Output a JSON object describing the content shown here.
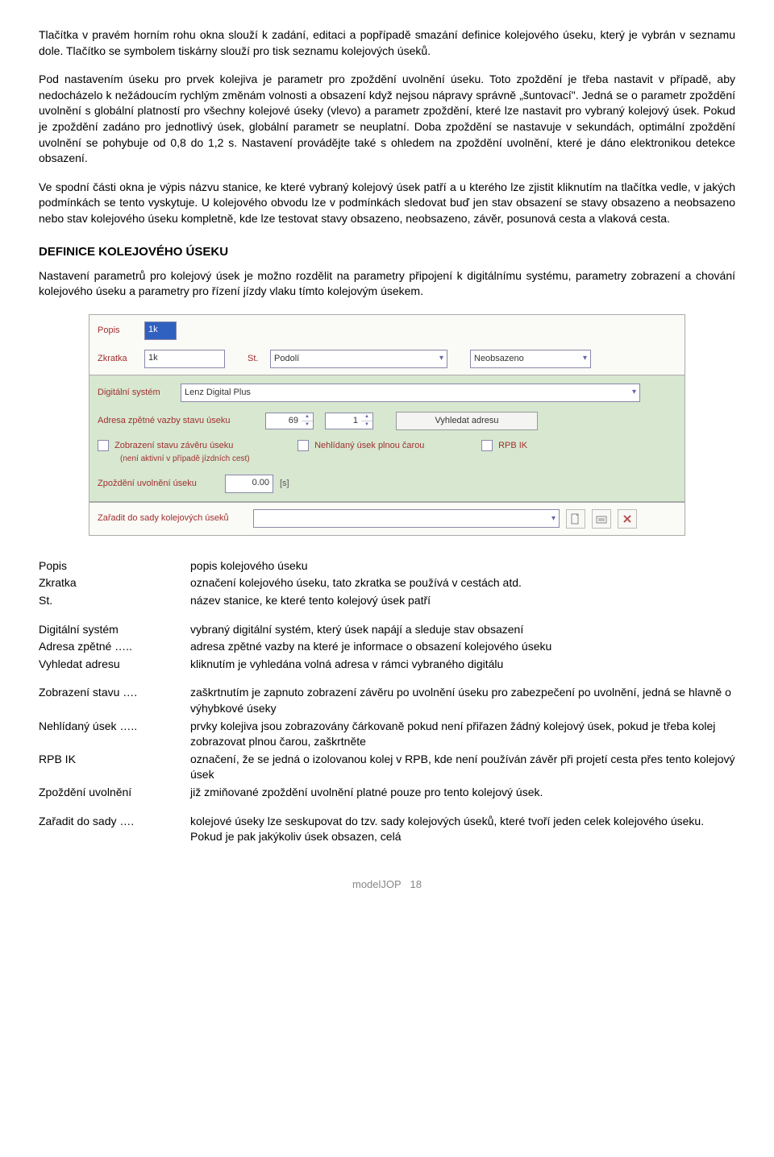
{
  "paragraphs": {
    "p1": "Tlačítka v pravém horním rohu okna slouží k zadání, editaci a popřípadě smazání definice kolejového úseku, který je vybrán v seznamu dole. Tlačítko se symbolem tiskárny slouží pro tisk seznamu kolejových úseků.",
    "p2": "Pod nastavením úseku pro prvek kolejiva je parametr pro zpoždění uvolnění úseku. Toto zpoždění je třeba nastavit v případě, aby nedocházelo k nežádoucím rychlým změnám volnosti a obsazení když nejsou nápravy správně „šuntovací\". Jedná se o parametr zpoždění uvolnění s globální platností pro všechny kolejové úseky (vlevo) a parametr zpoždění, které lze nastavit pro vybraný kolejový úsek. Pokud je zpoždění zadáno pro jednotlivý úsek, globální parametr se neuplatní. Doba zpoždění se nastavuje v sekundách, optimální zpoždění uvolnění se pohybuje od 0,8 do 1,2 s. Nastavení provádějte také s ohledem na zpoždění uvolnění, které je dáno elektronikou detekce obsazení.",
    "p3": "Ve spodní části okna je výpis názvu stanice, ke které vybraný kolejový úsek patří a u kterého lze zjistit kliknutím na tlačítka vedle, v jakých podmínkách se tento vyskytuje. U kolejového obvodu lze v podmínkách sledovat buď jen stav obsazení se stavy obsazeno a neobsazeno nebo stav kolejového úseku kompletně, kde lze testovat stavy obsazeno, neobsazeno, závěr, posunová cesta a vlaková cesta."
  },
  "heading": "DEFINICE KOLEJOVÉHO ÚSEKU",
  "def_intro": "Nastavení parametrů pro kolejový úsek je možno rozdělit na parametry připojení k digitálnímu systému, parametry zobrazení a chování kolejového úseku a parametry pro řízení jízdy vlaku tímto kolejovým úsekem.",
  "form": {
    "popis_label": "Popis",
    "popis_value": "1k",
    "zkratka_label": "Zkratka",
    "zkratka_value": "1k",
    "st_label": "St.",
    "st_value": "Podolí",
    "stav_value": "Neobsazeno",
    "system_label": "Digitální systém",
    "system_value": "Lenz Digital Plus",
    "adresa_label": "Adresa zpětné vazby stavu úseku",
    "adresa_val1": "69",
    "adresa_val2": "1",
    "vyhledat_btn": "Vyhledat adresu",
    "chk_zaver": "Zobrazení stavu závěru úseku",
    "chk_zaver_sub": "(není aktivní v případě jízdních cest)",
    "chk_nehlidany": "Nehlídaný úsek plnou čarou",
    "chk_rpb": "RPB IK",
    "zpozdeni_label": "Zpoždění uvolnění úseku",
    "zpozdeni_value": "0.00",
    "zpozdeni_unit": "[s]",
    "sada_label": "Zařadit do sady kolejových úseků"
  },
  "defs": [
    {
      "key": "Popis",
      "val": "popis kolejového úseku"
    },
    {
      "key": "Zkratka",
      "val": "označení kolejového úseku, tato zkratka se používá v cestách atd."
    },
    {
      "key": "St.",
      "val": "název stanice, ke které tento kolejový úsek patří"
    }
  ],
  "defs2": [
    {
      "key": "Digitální systém",
      "val": "vybraný digitální systém, který úsek napájí a sleduje stav obsazení"
    },
    {
      "key": "Adresa zpětné …..",
      "val": "adresa zpětné vazby na které je informace o obsazení kolejového úseku"
    },
    {
      "key": "Vyhledat adresu",
      "val": "kliknutím je vyhledána volná adresa v rámci vybraného digitálu"
    }
  ],
  "defs3": [
    {
      "key": "Zobrazení stavu ….",
      "val": "zaškrtnutím je zapnuto zobrazení závěru po uvolnění úseku pro zabezpečení po uvolnění, jedná se hlavně o výhybkové úseky"
    },
    {
      "key": "Nehlídaný úsek …..",
      "val": "prvky kolejiva jsou zobrazovány čárkovaně pokud není přiřazen žádný kolejový úsek, pokud je třeba kolej zobrazovat plnou čarou, zaškrtněte"
    },
    {
      "key": "RPB IK",
      "val": "označení, že se jedná o izolovanou kolej v RPB, kde není používán závěr při projetí cesta přes tento kolejový úsek"
    },
    {
      "key": "Zpoždění uvolnění",
      "val": "již zmiňované zpoždění uvolnění platné pouze pro tento kolejový úsek."
    }
  ],
  "defs4": [
    {
      "key": "Zařadit do sady ….",
      "val": "kolejové úseky lze seskupovat do tzv. sady kolejových úseků, které tvoří jeden celek kolejového úseku. Pokud je pak jakýkoliv úsek obsazen, celá"
    }
  ],
  "footer": {
    "app": "modelJOP",
    "page": "18"
  }
}
